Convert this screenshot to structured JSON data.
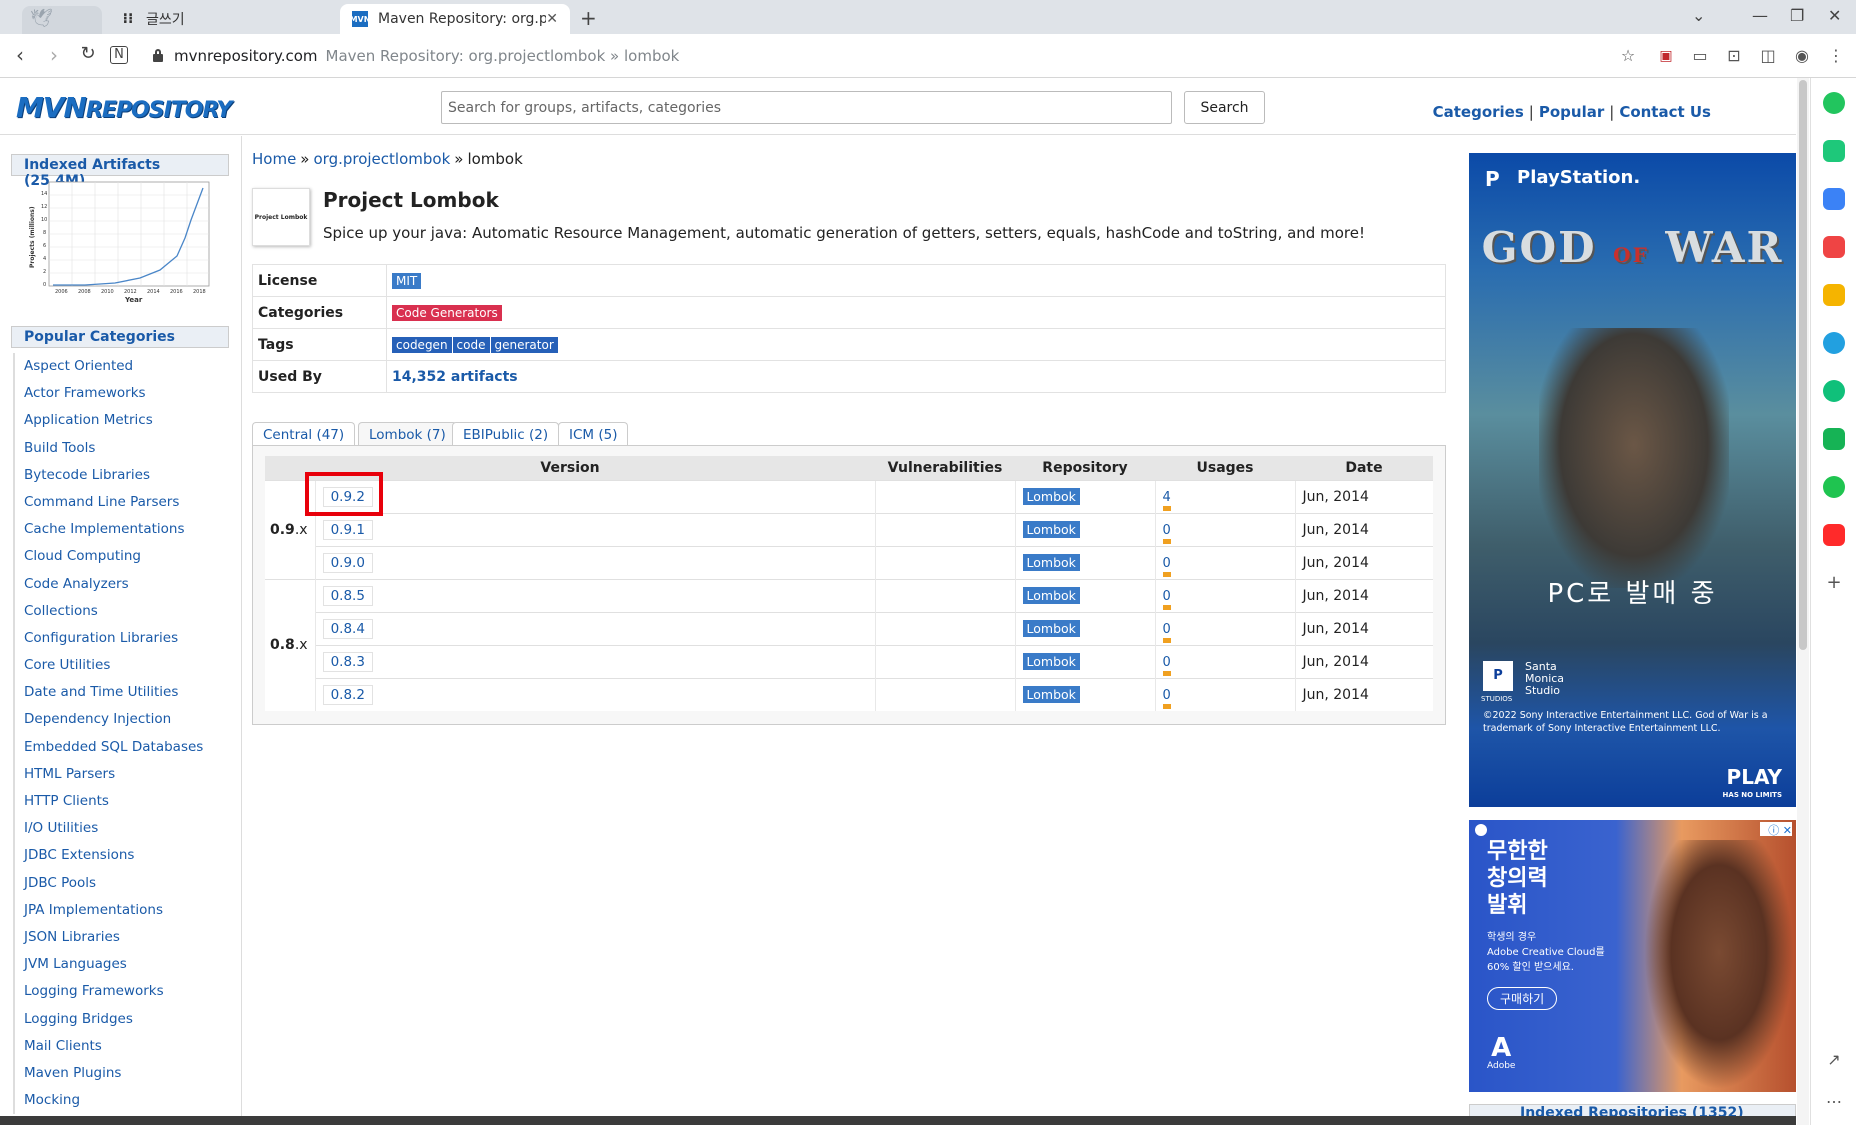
{
  "browser": {
    "tabs": [
      {
        "label": "글쓰기",
        "favicon": "dots-icon"
      },
      {
        "label": "Maven Repository: org.projectlo",
        "favicon": "MVN"
      }
    ],
    "new_tab_symbol": "+",
    "address": {
      "domain": "mvnrepository.com",
      "page_title": "Maven Repository: org.projectlombok » lombok"
    }
  },
  "site": {
    "logo_main": "MVN",
    "logo_sub": "REPOSITORY",
    "search_placeholder": "Search for groups, artifacts, categories",
    "search_button": "Search",
    "nav": [
      "Categories",
      "Popular",
      "Contact Us"
    ],
    "nav_separator": "|"
  },
  "sidebar": {
    "indexed_heading": "Indexed Artifacts (25.4M)",
    "mini_chart": {
      "ylabel": "Projects (millions)",
      "xlabel": "Year",
      "x_ticks": [
        "2006",
        "2008",
        "2010",
        "2012",
        "2014",
        "2016",
        "2018"
      ],
      "y_ticks": [
        "0",
        "2",
        "4",
        "6",
        "8",
        "10",
        "12",
        "14"
      ]
    },
    "popular_heading": "Popular Categories",
    "categories": [
      "Aspect Oriented",
      "Actor Frameworks",
      "Application Metrics",
      "Build Tools",
      "Bytecode Libraries",
      "Command Line Parsers",
      "Cache Implementations",
      "Cloud Computing",
      "Code Analyzers",
      "Collections",
      "Configuration Libraries",
      "Core Utilities",
      "Date and Time Utilities",
      "Dependency Injection",
      "Embedded SQL Databases",
      "HTML Parsers",
      "HTTP Clients",
      "I/O Utilities",
      "JDBC Extensions",
      "JDBC Pools",
      "JPA Implementations",
      "JSON Libraries",
      "JVM Languages",
      "Logging Frameworks",
      "Logging Bridges",
      "Mail Clients",
      "Maven Plugins",
      "Mocking"
    ]
  },
  "main": {
    "breadcrumb": {
      "home": "Home",
      "group": "org.projectlombok",
      "artifact": "lombok",
      "separator": "»"
    },
    "project_logo_text": "Project Lombok",
    "title": "Project Lombok",
    "description": "Spice up your java: Automatic Resource Management, automatic generation of getters, setters, equals, hashCode and toString, and more!",
    "info": {
      "license_label": "License",
      "license": "MIT",
      "categories_label": "Categories",
      "category": "Code Generators",
      "tags_label": "Tags",
      "tags": [
        "codegen",
        "code",
        "generator"
      ],
      "used_by_label": "Used By",
      "used_by": "14,352 artifacts"
    },
    "repo_tabs": [
      "Central (47)",
      "Lombok (7)",
      "EBIPublic (2)",
      "ICM (5)"
    ],
    "active_repo_tab": "Lombok (7)",
    "versions_table": {
      "headers": [
        "Version",
        "Vulnerabilities",
        "Repository",
        "Usages",
        "Date"
      ],
      "groups": [
        {
          "label": "0.9",
          "suffix": ".x",
          "rows": [
            {
              "version": "0.9.2",
              "repository": "Lombok",
              "usages": "4",
              "date": "Jun, 2014"
            },
            {
              "version": "0.9.1",
              "repository": "Lombok",
              "usages": "0",
              "date": "Jun, 2014"
            },
            {
              "version": "0.9.0",
              "repository": "Lombok",
              "usages": "0",
              "date": "Jun, 2014"
            }
          ]
        },
        {
          "label": "0.8",
          "suffix": ".x",
          "rows": [
            {
              "version": "0.8.5",
              "repository": "Lombok",
              "usages": "0",
              "date": "Jun, 2014"
            },
            {
              "version": "0.8.4",
              "repository": "Lombok",
              "usages": "0",
              "date": "Jun, 2014"
            },
            {
              "version": "0.8.3",
              "repository": "Lombok",
              "usages": "0",
              "date": "Jun, 2014"
            },
            {
              "version": "0.8.2",
              "repository": "Lombok",
              "usages": "0",
              "date": "Jun, 2014"
            }
          ]
        }
      ]
    },
    "highlighted_version": "0.9.2"
  },
  "ads": {
    "playstation": {
      "brand": "PlayStation.",
      "game_title_left": "GOD",
      "game_title_of": "OF",
      "game_title_right": "WAR",
      "tagline": "PC로 발매 중",
      "studio": "Santa\nMonica\nStudio",
      "studio_label": "STUDIOS",
      "legal": "©2022 Sony Interactive Entertainment LLC. God of War is a trademark of Sony Interactive Entertainment LLC.",
      "play": "PLAY",
      "play_sub": "HAS NO LIMITS"
    },
    "adobe": {
      "headline": [
        "무한한",
        "창의력",
        "발휘"
      ],
      "sub": [
        "학생의 경우",
        "Adobe Creative Cloud를",
        "60% 할인 받으세요."
      ],
      "cta": "구매하기",
      "logo": "Adobe"
    },
    "indexed_repositories_snippet": "Indexed Repositories (1352)"
  },
  "colors": {
    "link": "#1a5aa8",
    "badge_blue": "#3a7bc8",
    "badge_red": "#d9304f",
    "highlight": "#e8000b"
  }
}
